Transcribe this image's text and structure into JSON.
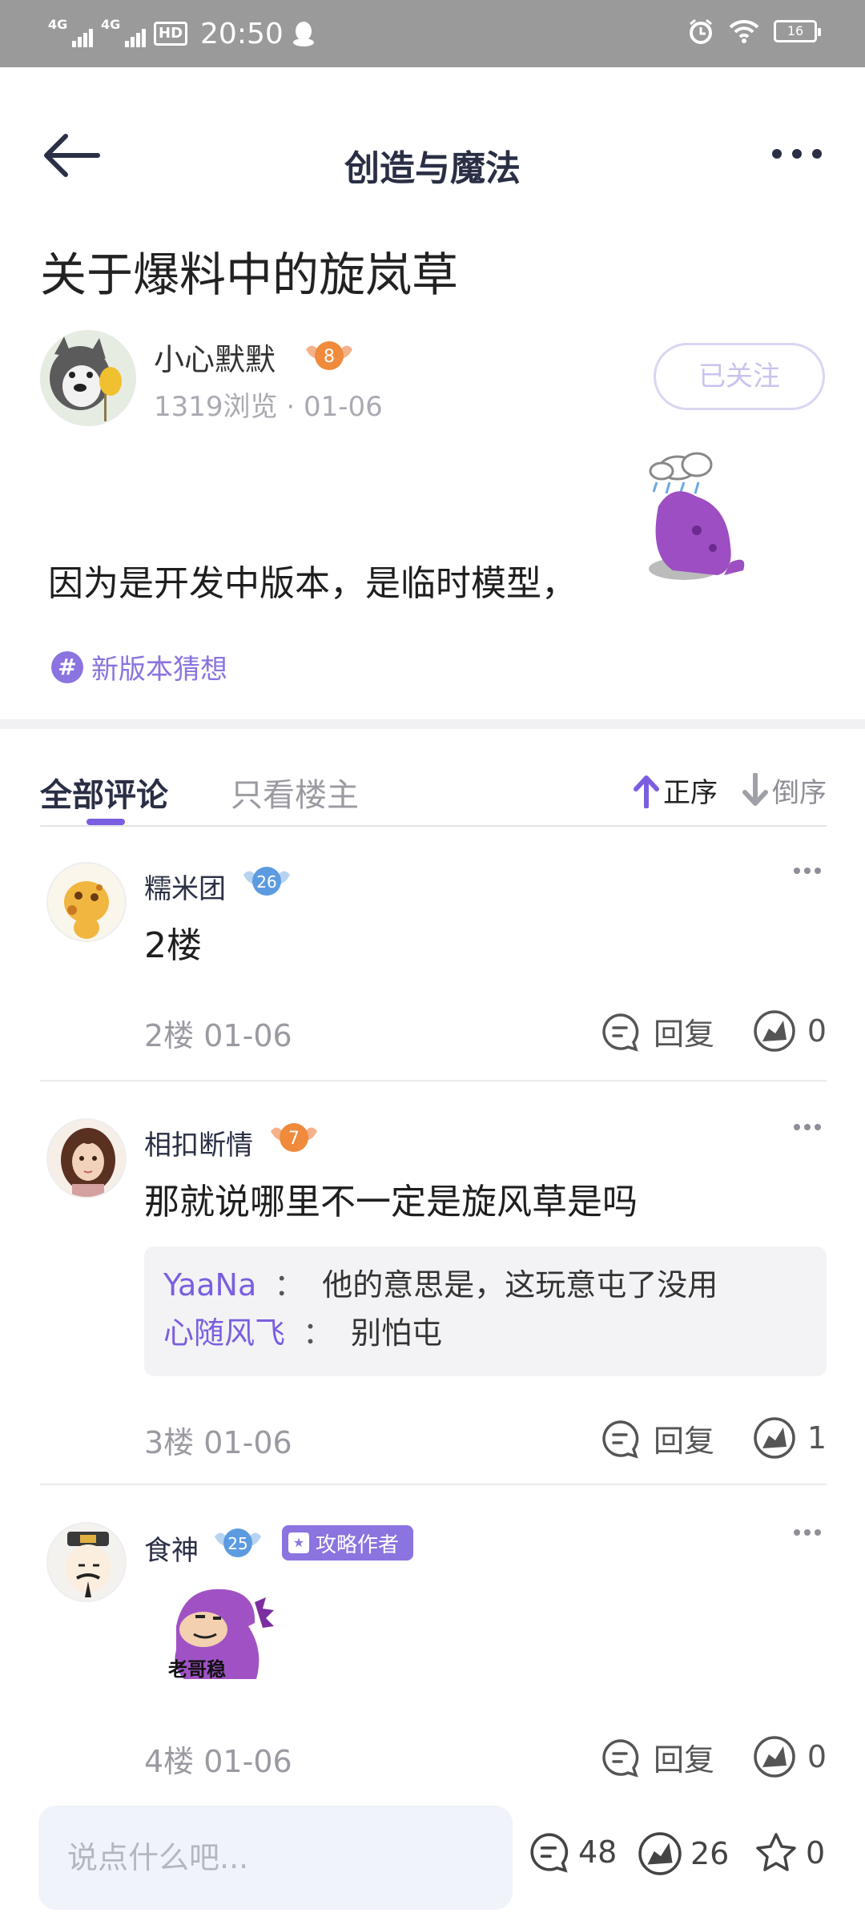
{
  "status_bar": {
    "time": "20:50",
    "network_1": "4G",
    "network_2": "4G",
    "hd": "HD",
    "battery": "16"
  },
  "header": {
    "title": "创造与魔法"
  },
  "post": {
    "title": "关于爆料中的旋岚草",
    "author_name": "小心默默",
    "author_level": "8",
    "meta": "1319浏览 · 01-06",
    "follow_label": "已关注",
    "body": "因为是开发中版本，是临时模型，",
    "topic": "新版本猜想"
  },
  "tabs": {
    "all": "全部评论",
    "owner_only": "只看楼主",
    "sort_asc": "正序",
    "sort_desc": "倒序"
  },
  "comments": [
    {
      "name": "糯米团",
      "level": "26",
      "text": "2楼",
      "floor": "2楼  01-06",
      "reply_label": "回复",
      "likes": "0"
    },
    {
      "name": "相扣断情",
      "level": "7",
      "text": "那就说哪里不一定是旋风草是吗",
      "floor": "3楼  01-06",
      "reply_label": "回复",
      "likes": "1",
      "replies": [
        {
          "who": "YaaNa",
          "sep": "：",
          "text": "他的意思是，这玩意屯了没用"
        },
        {
          "who": "心随风飞",
          "sep": "：",
          "text": "别怕屯"
        }
      ]
    },
    {
      "name": "食神",
      "level": "25",
      "tag": "攻略作者",
      "sticker_caption": "老哥稳",
      "floor": "4楼  01-06",
      "reply_label": "回复",
      "likes": "0"
    }
  ],
  "bottom_bar": {
    "placeholder": "说点什么吧...",
    "comments": "48",
    "likes": "26",
    "favorites": "0"
  },
  "colors": {
    "accent": "#7b5ee0",
    "status_bar": "#9a9a9a",
    "text_dark": "#2a2f45",
    "text_muted": "#9a9aa2"
  }
}
